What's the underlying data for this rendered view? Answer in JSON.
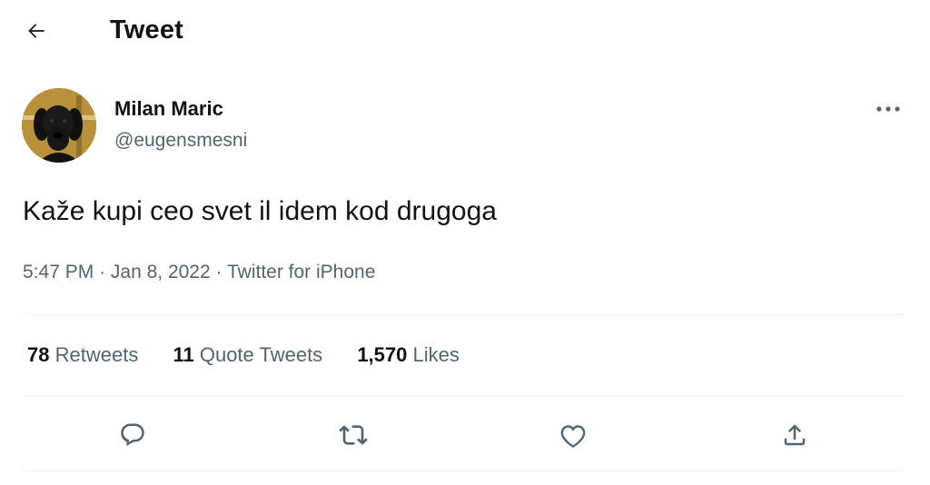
{
  "header": {
    "title": "Tweet"
  },
  "author": {
    "name": "Milan Maric",
    "handle": "@eugensmesni"
  },
  "tweet": {
    "text": "Kaže kupi ceo svet il idem kod drugoga",
    "time": "5:47 PM",
    "date": "Jan 8, 2022",
    "source": "Twitter for iPhone",
    "separator": "·"
  },
  "stats": {
    "retweets_count": "78",
    "retweets_label": "Retweets",
    "quotes_count": "11",
    "quotes_label": "Quote Tweets",
    "likes_count": "1,570",
    "likes_label": "Likes"
  },
  "icons": {
    "back": "arrow-left-icon",
    "more": "more-horizontal-icon",
    "reply": "reply-icon",
    "retweet": "retweet-icon",
    "like": "heart-icon",
    "share": "share-icon"
  },
  "colors": {
    "text_primary": "#0f1419",
    "text_secondary": "#536471",
    "divider": "#eff3f4",
    "background": "#ffffff"
  }
}
